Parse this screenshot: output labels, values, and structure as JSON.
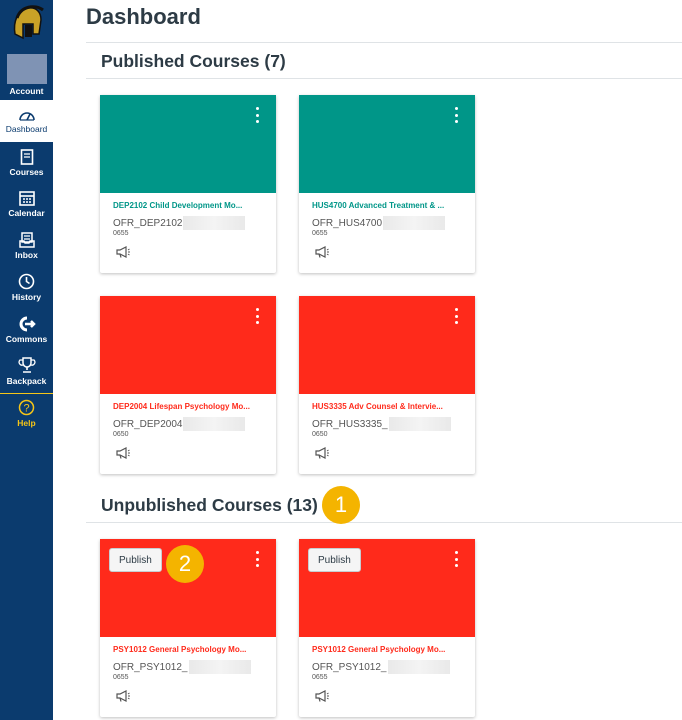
{
  "page": {
    "title": "Dashboard"
  },
  "colors": {
    "teal": "#009688",
    "red": "#ff2a1b",
    "sidebar": "#0b3b6e",
    "badge": "#f4b400"
  },
  "sidebar": {
    "items": [
      {
        "label": "Account",
        "icon": "avatar"
      },
      {
        "label": "Dashboard",
        "icon": "dashboard-icon"
      },
      {
        "label": "Courses",
        "icon": "book-icon"
      },
      {
        "label": "Calendar",
        "icon": "calendar-icon"
      },
      {
        "label": "Inbox",
        "icon": "inbox-icon"
      },
      {
        "label": "History",
        "icon": "clock-icon"
      },
      {
        "label": "Commons",
        "icon": "commons-icon"
      },
      {
        "label": "Backpack",
        "icon": "trophy-icon"
      },
      {
        "label": "Help",
        "icon": "help-icon"
      }
    ]
  },
  "sections": {
    "published": "Published Courses (7)",
    "unpublished": "Unpublished Courses (13)"
  },
  "cards": [
    {
      "name": "DEP2102 Child Development Mo...",
      "code": "OFR_DEP2102",
      "term": "0655",
      "color": "#009688"
    },
    {
      "name": "HUS4700 Advanced Treatment & ...",
      "code": "OFR_HUS4700",
      "term": "0655",
      "color": "#009688"
    },
    {
      "name": "DEP2004 Lifespan Psychology Mo...",
      "code": "OFR_DEP2004",
      "term": "0650",
      "color": "#ff2a1b"
    },
    {
      "name": "HUS3335 Adv Counsel & Intervie...",
      "code": "OFR_HUS3335_",
      "term": "0650",
      "color": "#ff2a1b"
    },
    {
      "name": "PSY1012 General Psychology Mo...",
      "code": "OFR_PSY1012_",
      "term": "0655",
      "color": "#ff2a1b",
      "publish": "Publish"
    },
    {
      "name": "PSY1012 General Psychology Mo...",
      "code": "OFR_PSY1012_",
      "term": "0655",
      "color": "#ff2a1b",
      "publish": "Publish"
    }
  ],
  "badges": {
    "one": "1",
    "two": "2"
  }
}
